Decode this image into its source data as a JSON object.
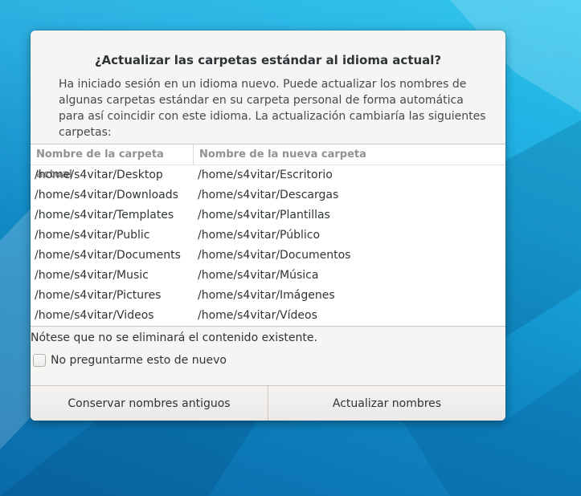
{
  "dialog": {
    "title": "¿Actualizar las carpetas estándar al idioma actual?",
    "description": "Ha iniciado sesión en un idioma nuevo. Puede actualizar los nombres de algunas carpetas estándar en su carpeta personal de forma automática para así coincidir con este idioma. La actualización cambiaría las siguientes carpetas:",
    "table": {
      "headers": [
        "Nombre de la carpeta actual",
        "Nombre de la nueva carpeta"
      ],
      "rows": [
        [
          "/home/s4vitar/Desktop",
          "/home/s4vitar/Escritorio"
        ],
        [
          "/home/s4vitar/Downloads",
          "/home/s4vitar/Descargas"
        ],
        [
          "/home/s4vitar/Templates",
          "/home/s4vitar/Plantillas"
        ],
        [
          "/home/s4vitar/Public",
          "/home/s4vitar/Público"
        ],
        [
          "/home/s4vitar/Documents",
          "/home/s4vitar/Documentos"
        ],
        [
          "/home/s4vitar/Music",
          "/home/s4vitar/Música"
        ],
        [
          "/home/s4vitar/Pictures",
          "/home/s4vitar/Imágenes"
        ],
        [
          "/home/s4vitar/Videos",
          "/home/s4vitar/Vídeos"
        ]
      ]
    },
    "note": "Nótese que no se eliminará el contenido existente.",
    "checkbox": {
      "label": "No preguntarme esto de nuevo",
      "checked": false
    },
    "buttons": {
      "keep": "Conservar nombres antiguos",
      "update": "Actualizar nombres"
    }
  }
}
